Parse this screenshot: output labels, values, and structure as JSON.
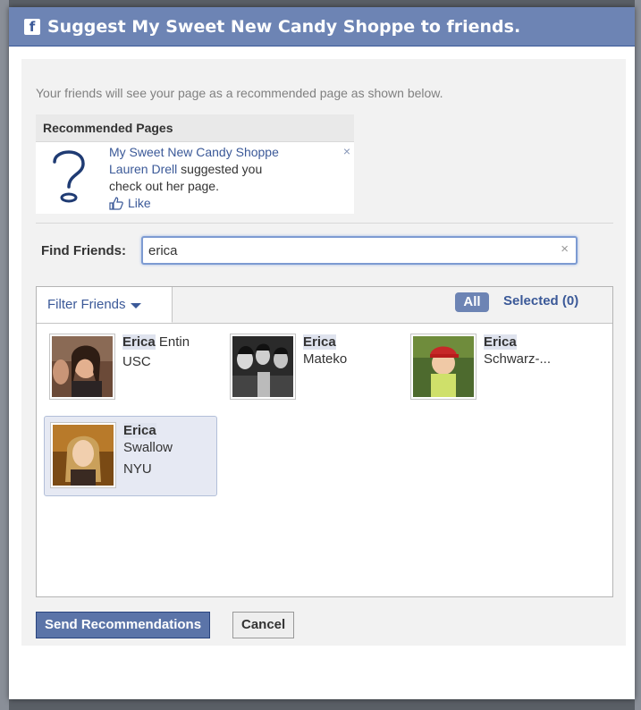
{
  "dialog": {
    "title": "Suggest My Sweet New Candy Shoppe to friends.",
    "intro": "Your friends will see your page as a recommended page as shown below."
  },
  "recommended": {
    "header": "Recommended Pages",
    "page_name": "My Sweet New Candy Shoppe",
    "suggester": "Lauren Drell",
    "suggest_text_1": "suggested you",
    "suggest_text_2": "check out her page.",
    "like_label": "Like",
    "close_glyph": "×"
  },
  "find": {
    "label": "Find Friends:",
    "value": "erica",
    "clear_glyph": "×"
  },
  "toolbar": {
    "filter_label": "Filter Friends",
    "all_label": "All",
    "selected_label": "Selected (0)"
  },
  "friends": [
    {
      "first": "Erica",
      "last": "Entin",
      "network": "USC",
      "selected": false
    },
    {
      "first": "Erica",
      "last": "Mateko",
      "network": "",
      "selected": false
    },
    {
      "first": "Erica",
      "last": "Schwarz-...",
      "network": "",
      "selected": false
    },
    {
      "first": "Erica",
      "last": "Swallow",
      "network": "NYU",
      "selected": true
    }
  ],
  "buttons": {
    "send": "Send Recommendations",
    "cancel": "Cancel"
  },
  "colors": {
    "titlebar": "#6d84b4",
    "link": "#3b5998",
    "highlight": "#dfe3ee"
  },
  "icons": {
    "app": "facebook-f-icon",
    "placeholder": "question-mark-icon",
    "like": "thumbs-up-icon"
  }
}
